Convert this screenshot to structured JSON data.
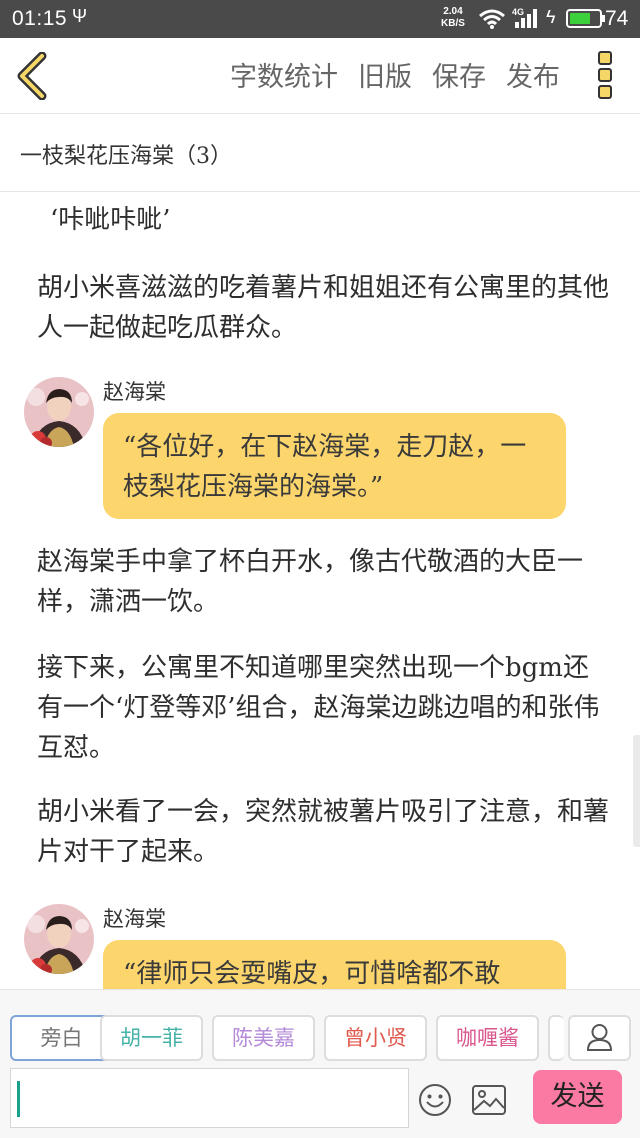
{
  "status_bar": {
    "time": "01:15",
    "net_speed_value": "2.04",
    "net_speed_unit": "KB/S",
    "network_type": "4G",
    "battery_level": "74",
    "battery_fraction": 0.74,
    "battery_color": "#3cd03c"
  },
  "toolbar": {
    "actions": [
      "字数统计",
      "旧版",
      "保存",
      "发布"
    ],
    "accent_color": "#f4d766"
  },
  "chapter": {
    "title": "一枝梨花压海棠（3）"
  },
  "content": {
    "p1": "‘咔呲咔呲’",
    "p2": "胡小米喜滋滋的吃着薯片和姐姐还有公寓里的其他人一起做起吃瓜群众。",
    "dialog1": {
      "speaker": "赵海棠",
      "text": "“各位好，在下赵海棠，走刀赵，一枝梨花压海棠的海棠。”"
    },
    "p3": "赵海棠手中拿了杯白开水，像古代敬酒的大臣一样，潇洒一饮。",
    "p4": "接下来，公寓里不知道哪里突然出现一个bgm还有一个‘灯登等邓’组合，赵海棠边跳边唱的和张伟互怼。",
    "p5": "胡小米看了一会，突然就被薯片吸引了注意，和薯片对干了起来。",
    "dialog2": {
      "speaker": "赵海棠",
      "text": "“律师只会耍嘴皮，可惜啥都不敢"
    },
    "bubble_color": "#fcd66c"
  },
  "bottom": {
    "roles": [
      {
        "label": "旁白",
        "color": "#777777"
      },
      {
        "label": "胡一菲",
        "color": "#46b3a8"
      },
      {
        "label": "陈美嘉",
        "color": "#b58ad8"
      },
      {
        "label": "曾小贤",
        "color": "#e05a4e"
      },
      {
        "label": "咖喱酱",
        "color": "#d9558d"
      }
    ],
    "send_label": "发送",
    "send_color": "#fb7aa4"
  }
}
